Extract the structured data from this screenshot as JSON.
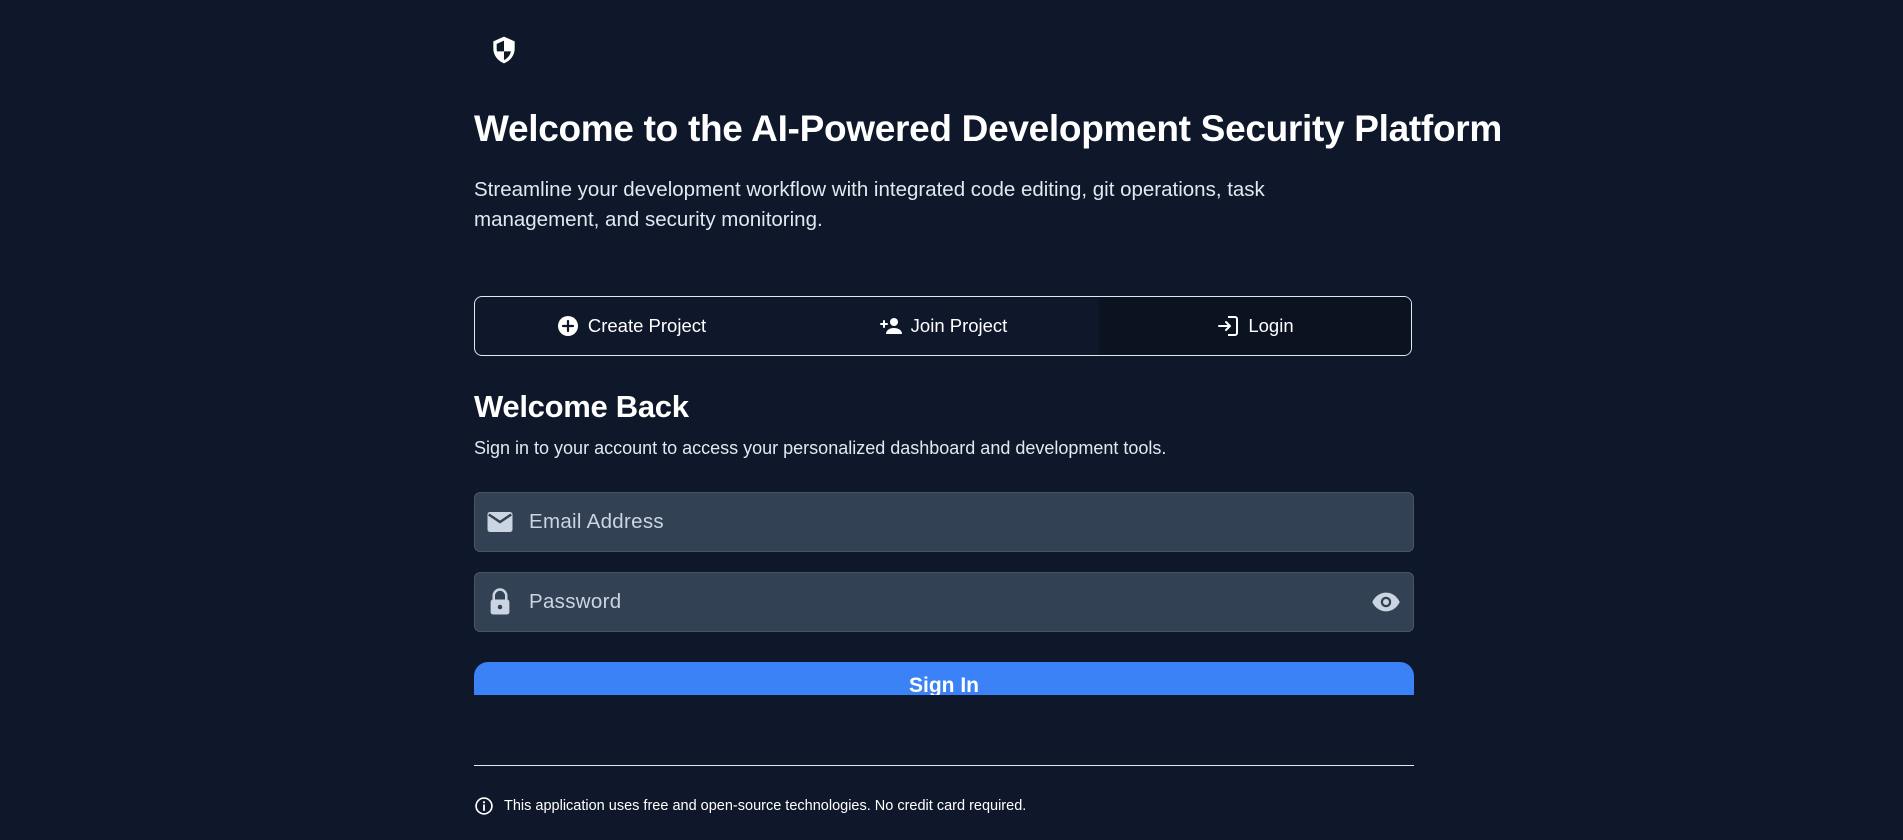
{
  "hero": {
    "logo_icon": "shield-icon",
    "title": "Welcome to the AI-Powered Development Security Platform",
    "subtitle": "Streamline your development workflow with integrated code editing, git operations, task management, and security monitoring."
  },
  "tabs": [
    {
      "label": "Create Project",
      "icon": "add-circle-icon",
      "active": false
    },
    {
      "label": "Join Project",
      "icon": "person-add-icon",
      "active": false
    },
    {
      "label": "Login",
      "icon": "login-icon",
      "active": true
    }
  ],
  "login_form": {
    "title": "Welcome Back",
    "description": "Sign in to your account to access your personalized dashboard and development tools.",
    "email": {
      "placeholder": "Email Address",
      "value": "",
      "icon": "mail-icon"
    },
    "password": {
      "placeholder": "Password",
      "value": "",
      "icon": "lock-icon",
      "toggle_icon": "eye-icon"
    },
    "submit_label": "Sign In"
  },
  "footer": {
    "icon": "info-icon",
    "note": "This application uses free and open-source technologies. No credit card required."
  },
  "colors": {
    "background": "#0f172a",
    "field_background": "#334155",
    "accent": "#3b82f6",
    "text": "#ffffff"
  }
}
